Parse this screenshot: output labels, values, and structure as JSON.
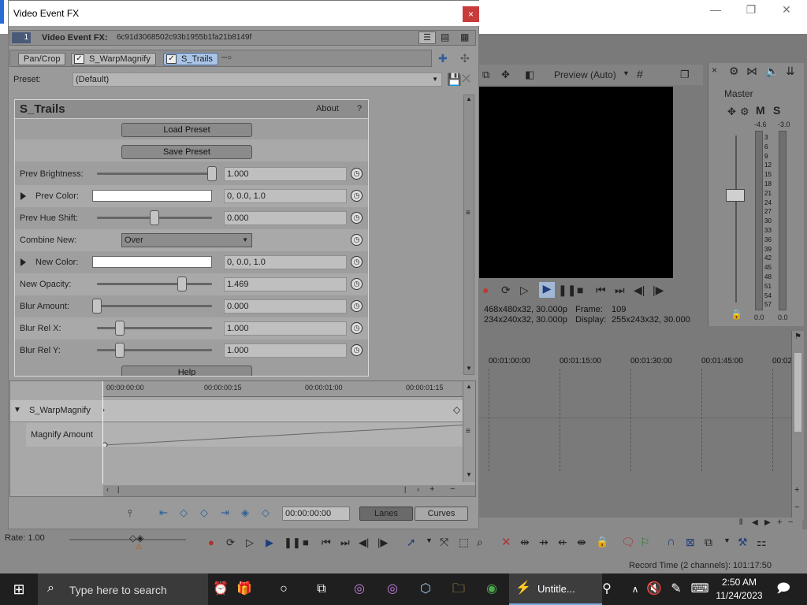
{
  "window": {
    "title": "Video Event FX",
    "close": "×"
  },
  "app_controls": {
    "minimize": "—",
    "maximize": "❐",
    "close": "✕"
  },
  "fx_header": {
    "track_num": "1",
    "label": "Video Event FX:",
    "id": "6c91d3068502c93b1955b1fa21b8149f"
  },
  "chain": {
    "tabs": [
      {
        "label": "Pan/Crop"
      },
      {
        "label": "S_WarpMagnify"
      },
      {
        "label": "S_Trails"
      }
    ]
  },
  "preset": {
    "label": "Preset:",
    "value": "(Default)"
  },
  "plugin": {
    "name": "S_Trails",
    "about": "About",
    "help_q": "?",
    "load_preset": "Load Preset",
    "save_preset": "Save Preset",
    "help": "Help",
    "params": [
      {
        "label": "Prev Brightness:",
        "value": "1.000",
        "level": 1.0
      },
      {
        "label": "Prev Color:",
        "value": "0, 0.0, 1.0"
      },
      {
        "label": "Prev Hue Shift:",
        "value": "0.000",
        "level": 0.5
      },
      {
        "label": "Combine New:",
        "value": "Over"
      },
      {
        "label": "New Color:",
        "value": "0, 0.0, 1.0"
      },
      {
        "label": "New Opacity:",
        "value": "1.469",
        "level": 0.74
      },
      {
        "label": "Blur Amount:",
        "value": "0.000",
        "level": 0.0
      },
      {
        "label": "Blur Rel X:",
        "value": "1.000",
        "level": 0.2
      },
      {
        "label": "Blur Rel Y:",
        "value": "1.000",
        "level": 0.2
      }
    ]
  },
  "keyframes": {
    "ruler": [
      "00:00:00:00",
      "00:00:00:15",
      "00:00:01:00",
      "00:00:01:15"
    ],
    "track": "S_WarpMagnify",
    "param": "Magnify Amount",
    "time": "00:00:00:00",
    "lanes": "Lanes",
    "curves": "Curves"
  },
  "preview": {
    "mode": "Preview (Auto)",
    "info_left1": "468x480x32, 30.000p",
    "info_left2": "234x240x32, 30.000p",
    "frame_label": "Frame:",
    "frame_value": "109",
    "display_label": "Display:",
    "display_value": "255x243x32, 30.000"
  },
  "mixer": {
    "label": "Master",
    "m": "M",
    "s": "S",
    "peak_l": "-4.6",
    "peak_r": "-3.0",
    "scale": [
      "3",
      "6",
      "9",
      "12",
      "15",
      "18",
      "21",
      "24",
      "27",
      "30",
      "33",
      "36",
      "39",
      "42",
      "45",
      "48",
      "51",
      "54",
      "57"
    ],
    "bottom_l": "0.0",
    "bottom_r": "0.0"
  },
  "timeline": {
    "ruler": [
      "00:01:00:00",
      "00:01:15:00",
      "00:01:30:00",
      "00:01:45:00",
      "00:02"
    ]
  },
  "status": {
    "rate": "Rate: 1.00",
    "record": "Record Time (2 channels): 101:17:50"
  },
  "taskbar": {
    "search": "Type here to search",
    "app": "Untitle...",
    "time": "2:50 AM",
    "date": "11/24/2023"
  },
  "colors": {
    "fx_bg": "#9a9a9a",
    "accent": "#a9c4e6",
    "taskbar": "#1f1f1f"
  }
}
